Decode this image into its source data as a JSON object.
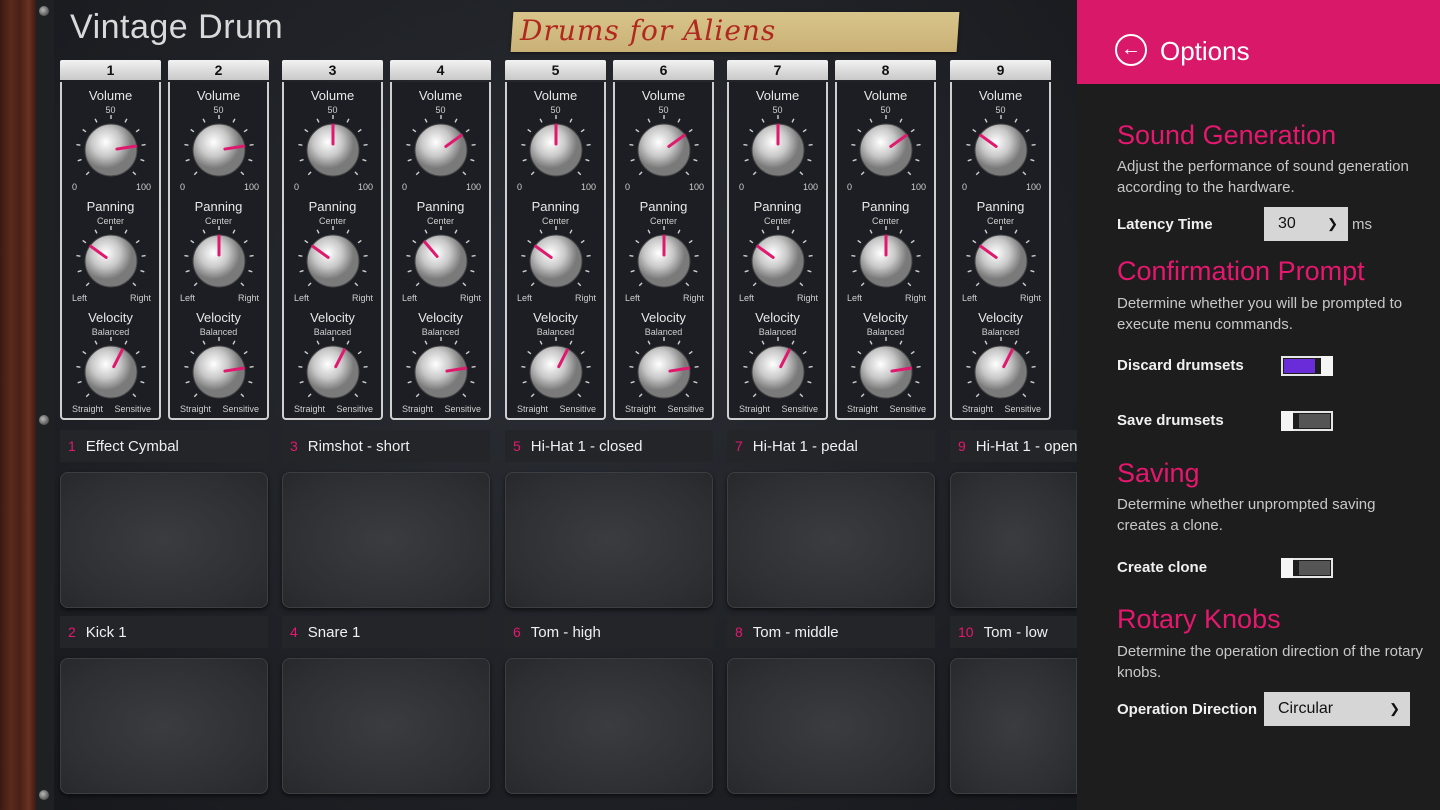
{
  "app": {
    "title": "Vintage Drum",
    "drumset_name": "Drums for Aliens"
  },
  "channels": [
    {
      "num": "1",
      "volume": 80,
      "panning": -40,
      "velocity": 60
    },
    {
      "num": "2",
      "volume": 80,
      "panning": 0,
      "velocity": 80
    },
    {
      "num": "3",
      "volume": 50,
      "panning": -40,
      "velocity": 60
    },
    {
      "num": "4",
      "volume": 70,
      "panning": -30,
      "velocity": 80
    },
    {
      "num": "5",
      "volume": 50,
      "panning": -40,
      "velocity": 60
    },
    {
      "num": "6",
      "volume": 70,
      "panning": 0,
      "velocity": 80
    },
    {
      "num": "7",
      "volume": 50,
      "panning": -40,
      "velocity": 60
    },
    {
      "num": "8",
      "volume": 70,
      "panning": 0,
      "velocity": 80
    },
    {
      "num": "9",
      "volume": 30,
      "panning": -40,
      "velocity": 60
    }
  ],
  "knob_labels": {
    "volume": "Volume",
    "volume_mid": "50",
    "volume_min": "0",
    "volume_max": "100",
    "panning": "Panning",
    "panning_mid": "Center",
    "panning_min": "Left",
    "panning_max": "Right",
    "velocity": "Velocity",
    "velocity_mid": "Balanced",
    "velocity_min": "Straight",
    "velocity_max": "Sensitive"
  },
  "pads": [
    {
      "num": "1",
      "name": "Effect Cymbal"
    },
    {
      "num": "3",
      "name": "Rimshot - short"
    },
    {
      "num": "5",
      "name": "Hi-Hat 1 - closed"
    },
    {
      "num": "7",
      "name": "Hi-Hat 1 - pedal"
    },
    {
      "num": "9",
      "name": "Hi-Hat 1 - open"
    },
    {
      "num": "2",
      "name": "Kick 1"
    },
    {
      "num": "4",
      "name": "Snare 1"
    },
    {
      "num": "6",
      "name": "Tom - high"
    },
    {
      "num": "8",
      "name": "Tom - middle"
    },
    {
      "num": "10",
      "name": "Tom - low"
    }
  ],
  "options": {
    "title": "Options",
    "back_icon": "back-arrow-icon",
    "sound": {
      "title": "Sound Generation",
      "desc": "Adjust the performance of sound generation according to the hardware.",
      "latency_label": "Latency Time",
      "latency_value": "30",
      "latency_unit": "ms"
    },
    "confirm": {
      "title": "Confirmation Prompt",
      "desc": "Determine whether you will be prompted to execute menu commands.",
      "discard_label": "Discard drumsets",
      "discard_on": true,
      "save_label": "Save drumsets",
      "save_on": false
    },
    "saving": {
      "title": "Saving",
      "desc": "Determine whether unprompted saving creates a clone.",
      "clone_label": "Create clone",
      "clone_on": false
    },
    "rotary": {
      "title": "Rotary Knobs",
      "desc": "Determine the operation direction of the rotary knobs.",
      "direction_label": "Operation Direction",
      "direction_value": "Circular"
    },
    "colors": {
      "accent": "#d9186a",
      "accent_text": "#e6176e",
      "toggle_on": "#6a2bd9",
      "toggle_off": "#555555"
    }
  }
}
